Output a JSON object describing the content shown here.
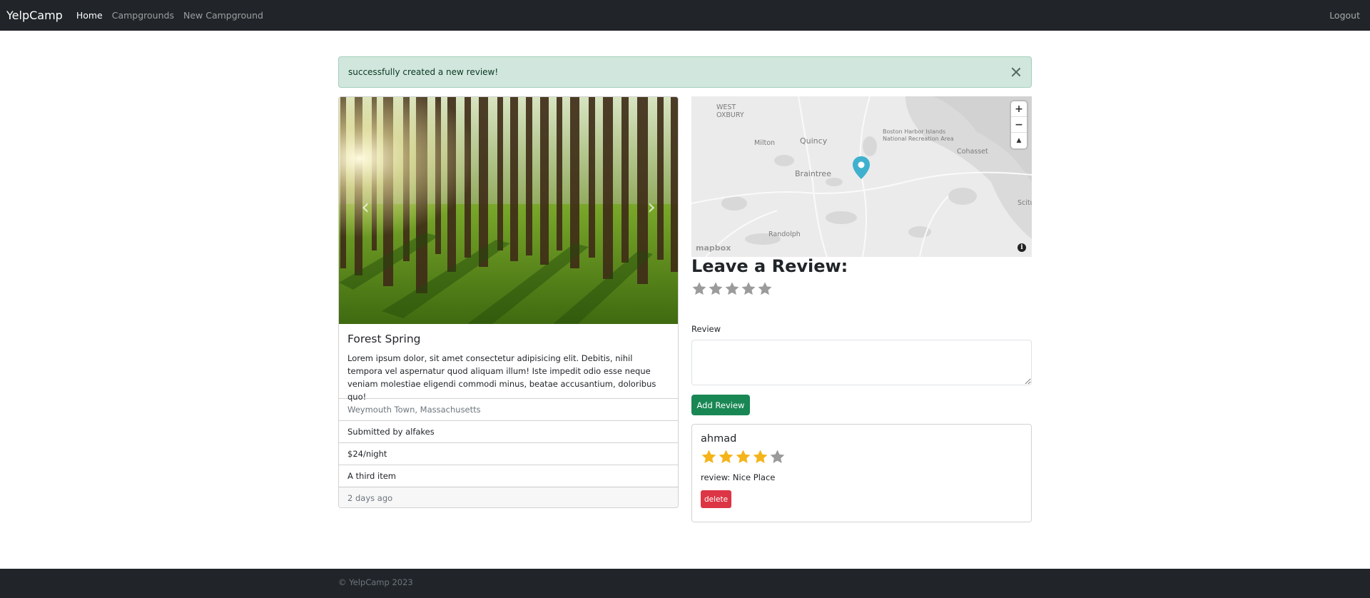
{
  "navbar": {
    "brand": "YelpCamp",
    "links": [
      "Home",
      "Campgrounds",
      "New Campground"
    ],
    "logout": "Logout"
  },
  "alert": {
    "message": "successfully created a new review!"
  },
  "campground": {
    "title": "Forest Spring",
    "description": "Lorem ipsum dolor, sit amet consectetur adipisicing elit. Debitis, nihil tempora vel aspernatur quod aliquam illum! Iste impedit odio esse neque veniam molestiae eligendi commodi minus, beatae accusantium, doloribus quo!",
    "location": "Weymouth Town, Massachusetts",
    "submitted_by": "Submitted by alfakes",
    "price": "$24/night",
    "third_item": "A third item",
    "posted": "2 days ago",
    "carousel_prev_icon": "chevron-left-icon",
    "carousel_next_icon": "chevron-right-icon"
  },
  "map": {
    "labels": [
      "Milton",
      "Quincy",
      "Braintree",
      "Randolph",
      "Cohasset",
      "Boston Harbor Islands",
      "National Recreation Area",
      "WEST",
      "OXBURY",
      "Scitu"
    ],
    "zoom_in": "+",
    "zoom_out": "−",
    "compass": "▲",
    "attribution": "mapbox",
    "info": "i",
    "pin_color": "#3fb1ce"
  },
  "review_form": {
    "heading": "Leave a Review:",
    "rating": 0,
    "max_rating": 5,
    "label": "Review",
    "submit": "Add Review"
  },
  "review": {
    "author": "ahmad",
    "rating": 4,
    "max_rating": 5,
    "text": "review: Nice Place",
    "delete": "delete"
  },
  "footer": {
    "text": "© YelpCamp 2023"
  },
  "colors": {
    "navbar_bg": "#212529",
    "alert_bg": "#d1e7dd",
    "success": "#198754",
    "danger": "#dc3545",
    "star_filled": "#f4b41a",
    "star_empty": "#9b9b9b"
  }
}
